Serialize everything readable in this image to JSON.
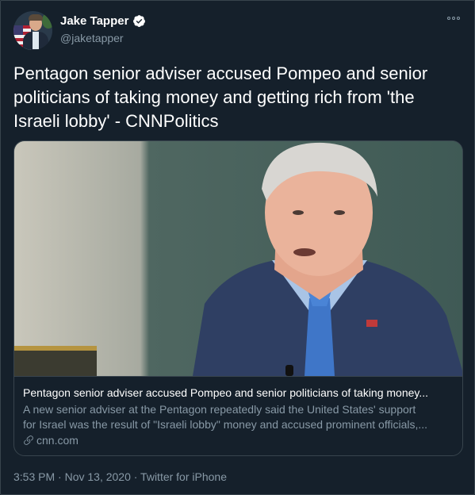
{
  "author": {
    "name": "Jake Tapper",
    "handle": "@jaketapper",
    "verified": true
  },
  "tweet": {
    "text": "Pentagon senior adviser accused Pompeo and senior politicians of taking money and getting rich from 'the Israeli lobby' - CNNPolitics"
  },
  "card": {
    "title": "Pentagon senior adviser accused Pompeo and senior politicians of taking money...",
    "description_line1": "A new senior adviser at the Pentagon repeatedly said the United States' support",
    "description_line2": "for Israel was the result of \"Israeli lobby\" money and accused prominent officials,...",
    "domain": "cnn.com"
  },
  "meta": {
    "timestamp": "3:53 PM · Nov 13, 2020 · Twitter for iPhone"
  },
  "colors": {
    "background": "#15202b",
    "border": "#38444d",
    "secondary_text": "#8899a6",
    "verified_blue": "#1da1f2"
  },
  "icons": [
    "more-icon",
    "verified-badge-icon",
    "link-icon"
  ]
}
